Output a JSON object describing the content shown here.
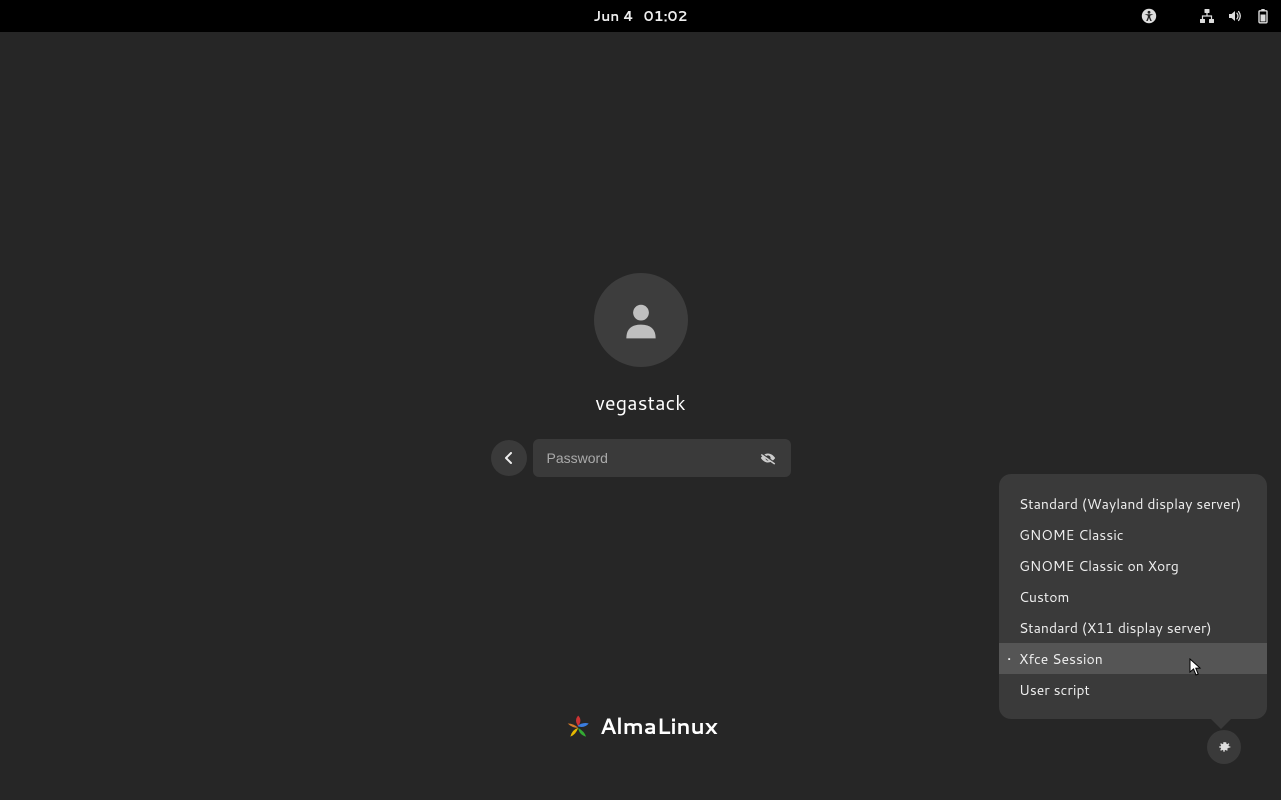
{
  "topbar": {
    "date": "Jun 4",
    "time": "01:02"
  },
  "login": {
    "username": "vegastack",
    "password_placeholder": "Password"
  },
  "branding": {
    "name": "AlmaLinux"
  },
  "session_menu": {
    "items": [
      {
        "label": "Standard (Wayland display server)",
        "selected": false
      },
      {
        "label": "GNOME Classic",
        "selected": false
      },
      {
        "label": "GNOME Classic on Xorg",
        "selected": false
      },
      {
        "label": "Custom",
        "selected": false
      },
      {
        "label": "Standard (X11 display server)",
        "selected": false
      },
      {
        "label": "Xfce Session",
        "selected": true
      },
      {
        "label": "User script",
        "selected": false
      }
    ]
  }
}
